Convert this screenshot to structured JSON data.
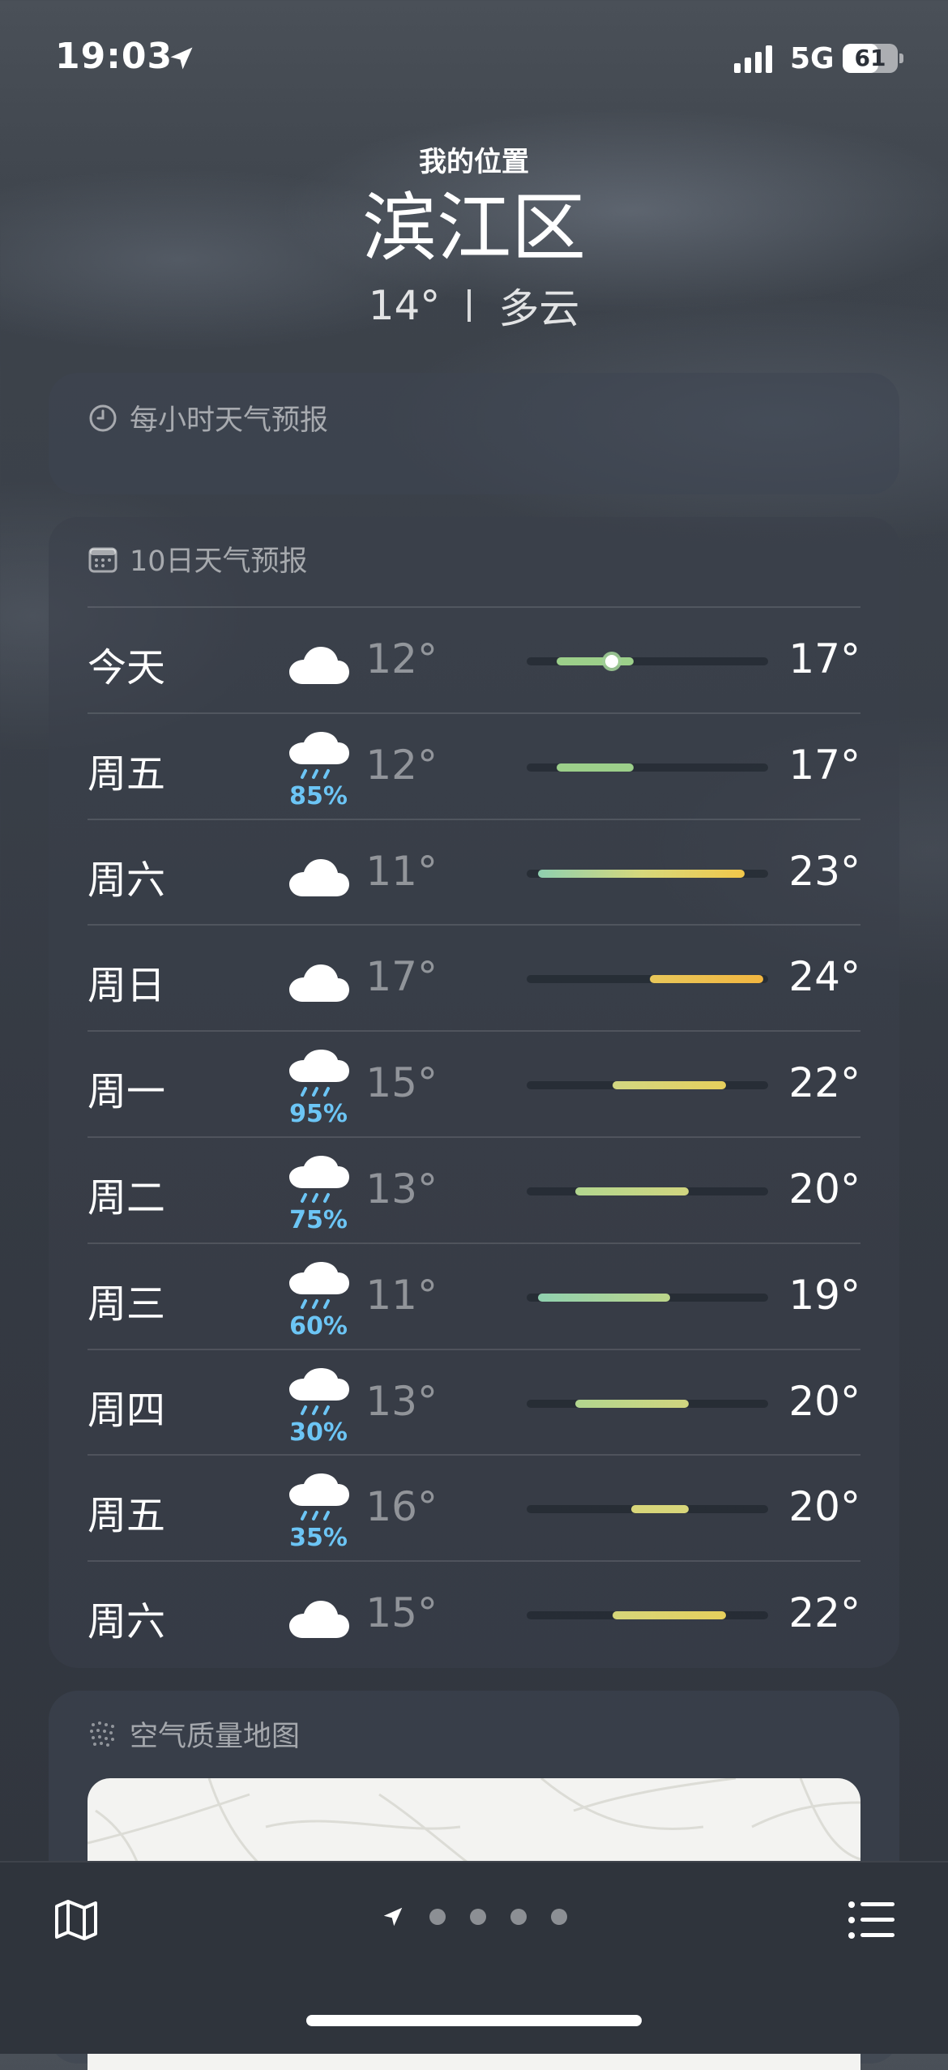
{
  "status": {
    "time": "19:03",
    "network": "5G",
    "battery": "61"
  },
  "header": {
    "my_location": "我的位置",
    "city": "滨江区",
    "temp": "14°",
    "condition": "多云"
  },
  "hourly": {
    "title": "每小时天气预报"
  },
  "ten_day": {
    "title": "10日天气预报",
    "range_min": 11,
    "range_max": 24,
    "current_temp": 14,
    "rows": [
      {
        "day": "今天",
        "icon": "cloud-icon",
        "pop": "",
        "low": "12°",
        "high": "17°",
        "low_v": 12,
        "high_v": 17,
        "current": true,
        "color": "#9ccf8a"
      },
      {
        "day": "周五",
        "icon": "rain-cloud-icon",
        "pop": "85%",
        "low": "12°",
        "high": "17°",
        "low_v": 12,
        "high_v": 17,
        "current": false,
        "color": "#9ccf8a"
      },
      {
        "day": "周六",
        "icon": "cloud-icon",
        "pop": "",
        "low": "11°",
        "high": "23°",
        "low_v": 11,
        "high_v": 23,
        "current": false,
        "color": "linear-gradient(90deg,#8fd0b0,#d6d87c,#f2c84a)"
      },
      {
        "day": "周日",
        "icon": "cloud-icon",
        "pop": "",
        "low": "17°",
        "high": "24°",
        "low_v": 17,
        "high_v": 24,
        "current": false,
        "color": "linear-gradient(90deg,#e8c75a,#f2b640)"
      },
      {
        "day": "周一",
        "icon": "rain-cloud-icon",
        "pop": "95%",
        "low": "15°",
        "high": "22°",
        "low_v": 15,
        "high_v": 22,
        "current": false,
        "color": "linear-gradient(90deg,#d2d782,#e6cf5c)"
      },
      {
        "day": "周二",
        "icon": "rain-cloud-icon",
        "pop": "75%",
        "low": "13°",
        "high": "20°",
        "low_v": 13,
        "high_v": 20,
        "current": false,
        "color": "linear-gradient(90deg,#b2d68f,#d1d57f)"
      },
      {
        "day": "周三",
        "icon": "rain-cloud-icon",
        "pop": "60%",
        "low": "11°",
        "high": "19°",
        "low_v": 11,
        "high_v": 19,
        "current": false,
        "color": "linear-gradient(90deg,#90d1b0,#bcd58a)"
      },
      {
        "day": "周四",
        "icon": "rain-cloud-icon",
        "pop": "30%",
        "low": "13°",
        "high": "20°",
        "low_v": 13,
        "high_v": 20,
        "current": false,
        "color": "linear-gradient(90deg,#b2d68f,#d1d57f)"
      },
      {
        "day": "周五",
        "icon": "rain-cloud-icon",
        "pop": "35%",
        "low": "16°",
        "high": "20°",
        "low_v": 16,
        "high_v": 20,
        "current": false,
        "color": "#d8d67a"
      },
      {
        "day": "周六",
        "icon": "cloud-icon",
        "pop": "",
        "low": "15°",
        "high": "22°",
        "low_v": 15,
        "high_v": 22,
        "current": false,
        "color": "linear-gradient(90deg,#d6d67a,#e6cf5c)"
      }
    ]
  },
  "air_quality": {
    "title": "空气质量地图"
  },
  "bottom_bar": {
    "pages": 4
  }
}
